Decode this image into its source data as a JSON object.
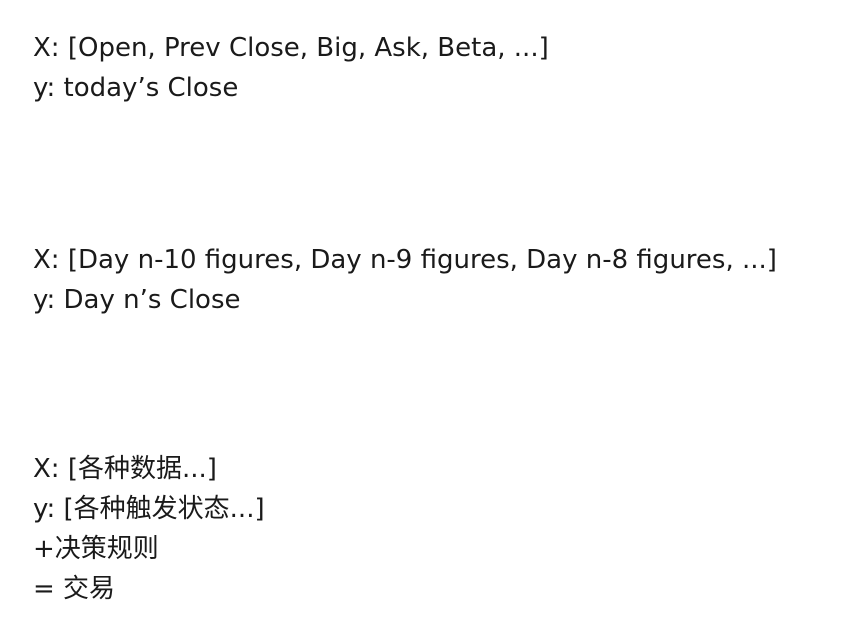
{
  "blocks": [
    {
      "lines": [
        "X: [Open, Prev Close, Big, Ask, Beta, ...]",
        "y: today’s Close"
      ]
    },
    {
      "lines": [
        "X: [Day n-10 figures, Day n-9 figures, Day n-8 figures, ...]",
        "y: Day n’s Close"
      ]
    },
    {
      "lines": [
        "X: [各种数据...]",
        "y: [各种触发状态...]",
        "+决策规则",
        "= 交易"
      ]
    }
  ]
}
